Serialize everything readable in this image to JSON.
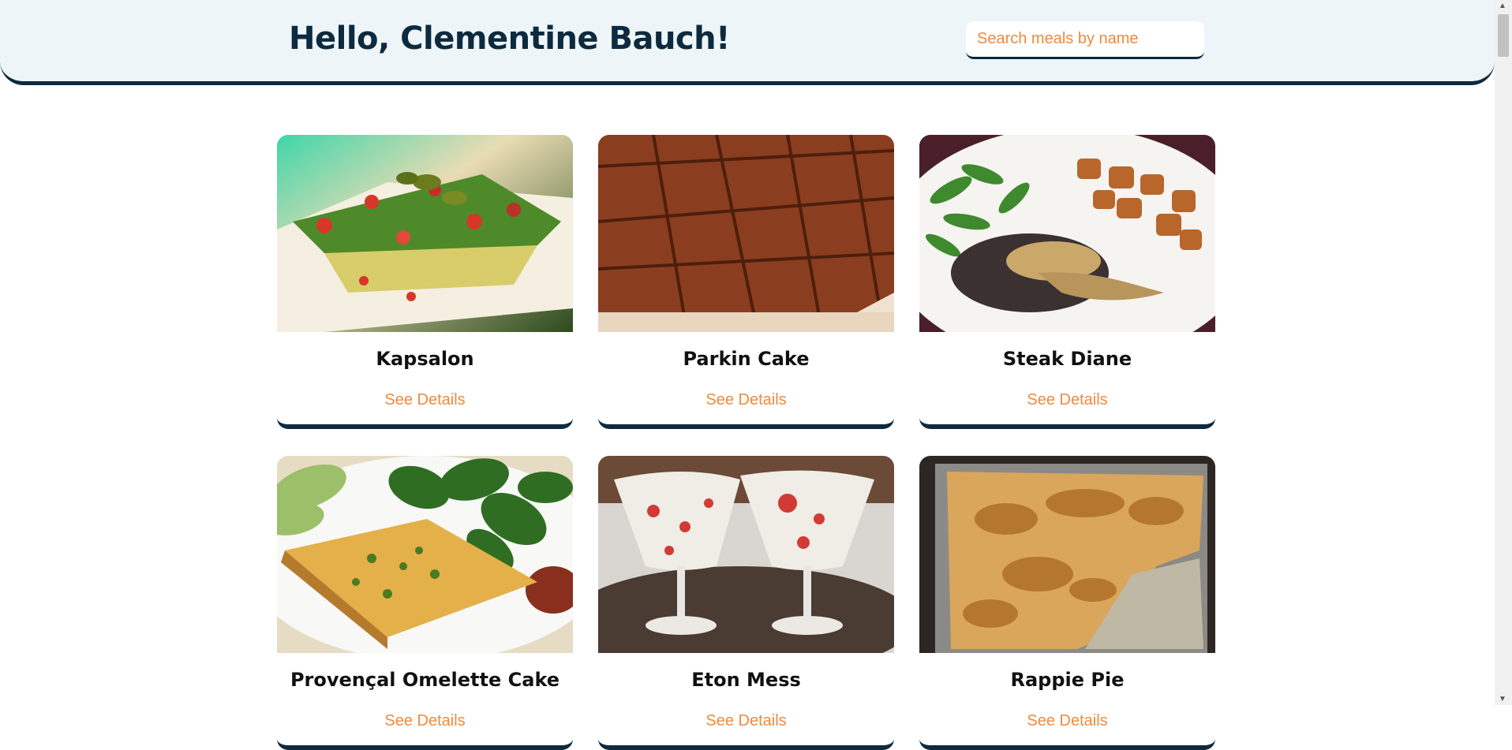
{
  "header": {
    "greeting": "Hello, Clementine Bauch!",
    "search_placeholder": "Search meals by name",
    "search_value": ""
  },
  "meals": [
    {
      "name": "Kapsalon",
      "link": "See Details"
    },
    {
      "name": "Parkin Cake",
      "link": "See Details"
    },
    {
      "name": "Steak Diane",
      "link": "See Details"
    },
    {
      "name": "Provençal Omelette Cake",
      "link": "See Details"
    },
    {
      "name": "Eton Mess",
      "link": "See Details"
    },
    {
      "name": "Rappie Pie",
      "link": "See Details"
    }
  ],
  "colors": {
    "accent": "#ef8a3e",
    "navy": "#0d2a3f",
    "header_bg": "#edf5f8"
  }
}
